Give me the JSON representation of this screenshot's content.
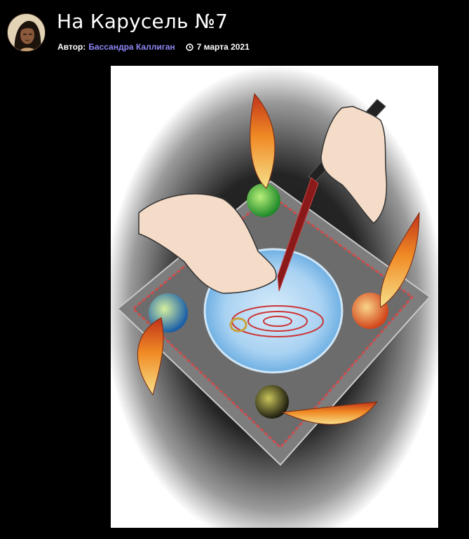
{
  "post": {
    "title": "На Карусель №7",
    "author_label": "Автор:",
    "author_name": "Бассандра Каллиган",
    "date": "7 марта 2021"
  },
  "icons": {
    "clock": "clock-icon"
  },
  "colors": {
    "background": "#000000",
    "title": "#ffffff",
    "author_link": "#8e86f5"
  }
}
